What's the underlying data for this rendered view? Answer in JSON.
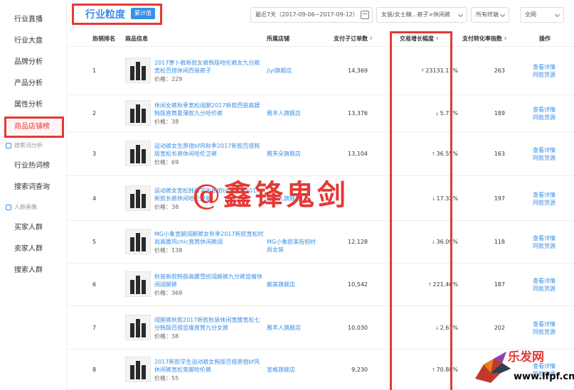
{
  "sidebar": {
    "items": [
      {
        "label": "行业直播"
      },
      {
        "label": "行业大盘"
      },
      {
        "label": "品牌分析"
      },
      {
        "label": "产品分析"
      },
      {
        "label": "属性分析"
      },
      {
        "label": "商品店铺榜"
      }
    ],
    "group_search": {
      "label": "搜索词分析"
    },
    "search_items": [
      {
        "label": "行业热词榜"
      },
      {
        "label": "搜索词查询"
      }
    ],
    "group_crowd": {
      "label": "人群画像"
    },
    "crowd_items": [
      {
        "label": "买家人群"
      },
      {
        "label": "卖家人群"
      },
      {
        "label": "搜索人群"
      }
    ]
  },
  "header": {
    "title": "行业粒度",
    "badge": "累计值",
    "date_range": "最近7天（2017-09-06~2017-09-12）",
    "category": "女装/女士精...裤子>休闲裤",
    "terminal": "所有终端",
    "network": "全网"
  },
  "table": {
    "columns": {
      "rank": "热销排名",
      "product": "商品信息",
      "store": "所属店铺",
      "orders": "支付子订单数",
      "growth": "交易增长幅度",
      "conversion": "支付转化率指数",
      "ops": "操作"
    },
    "op_detail": "查看详情",
    "op_same": "同款货源",
    "price_prefix": "价格：",
    "rows": [
      {
        "rank": "1",
        "name": "2017萝卜裤新款女裤韩版哈伦裤女九分裤宽松百搭休闲西装裤子",
        "price": "229",
        "store": "jiyi旗舰店",
        "orders": "14,369",
        "growth": "23131.11%",
        "dir": "up",
        "conv": "263"
      },
      {
        "rank": "2",
        "name": "休闲女裤秋季宽松阔腿2017新款西装高腰韩版直筒夏薄款九分哈伦裤",
        "price": "38",
        "store": "雅羊人旗舰店",
        "orders": "13,376",
        "growth": "5.71%",
        "dir": "down",
        "conv": "189"
      },
      {
        "rank": "3",
        "name": "运动裤女生原宿bf风秋季2017新款百搭韩版宽松长裤休闲哈伦卫裤",
        "price": "69",
        "store": "雅芙朵旗舰店",
        "orders": "13,104",
        "growth": "36.55%",
        "dir": "up",
        "conv": "163"
      },
      {
        "rank": "4",
        "name": "运动裤女宽松韩版学生原宿bf风秋季2017新款长裤休闲哈伦卫裤",
        "price": "38",
        "store": "雅羊人旗舰店",
        "orders": "",
        "growth": "17.32%",
        "dir": "down",
        "conv": "197"
      },
      {
        "rank": "5",
        "name": "MG小象宽腿阔腿裤女秋季2017新款宽松时尚高腰风chic直筒休闲裤阔",
        "price": "138",
        "store": "MG小象欧美街拍时尚女装",
        "orders": "12,128",
        "growth": "36.09%",
        "dir": "down",
        "conv": "118"
      },
      {
        "rank": "6",
        "name": "秋装新款韩版高腰雪纺阔腿裤九分裤显瘦休闲阔腿裤",
        "price": "369",
        "store": "靓美旗舰店",
        "orders": "10,542",
        "growth": "221.46%",
        "dir": "up",
        "conv": "187"
      },
      {
        "rank": "7",
        "name": "阔腿裤秋款2017新款秋装休闲宽腰宽松七分韩版百搭显瘦直筒九分女裤",
        "price": "38",
        "store": "雅羊人旗舰店",
        "orders": "10,030",
        "growth": "2.61%",
        "dir": "down",
        "conv": "202"
      },
      {
        "rank": "8",
        "name": "2017新款学生运动裤女韩版百搭原宿bf风休闲裤宽松束脚哈伦裤",
        "price": "55",
        "store": "宣格旗舰店",
        "orders": "9,230",
        "growth": "70.88%",
        "dir": "up",
        "conv": "160"
      }
    ]
  },
  "watermark": "@鑫锋鬼剑",
  "logo": {
    "text": "乐发网",
    "url": "www.lfpf.cn"
  },
  "colors": {
    "accent": "#3a8ee6",
    "highlight": "#e53935",
    "up": "#e53935",
    "down": "#2e9e44"
  }
}
